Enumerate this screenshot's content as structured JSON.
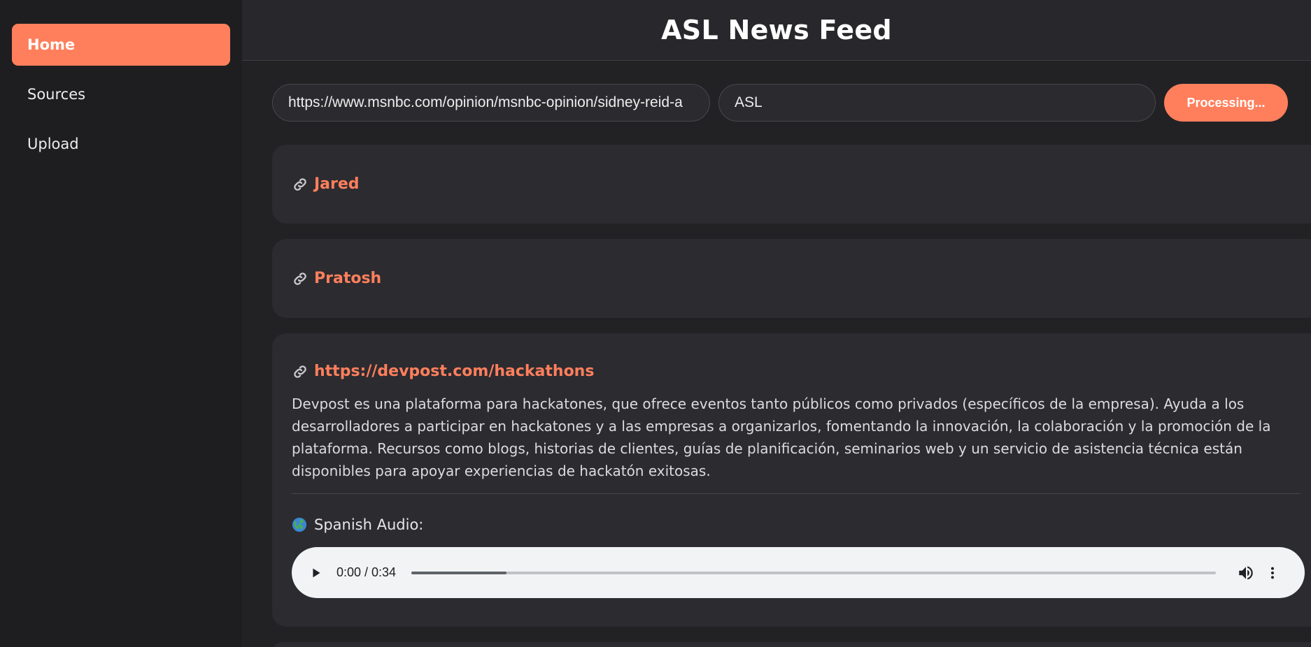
{
  "sidebar": {
    "items": [
      {
        "label": "Home",
        "active": true
      },
      {
        "label": "Sources",
        "active": false
      },
      {
        "label": "Upload",
        "active": false
      }
    ]
  },
  "header": {
    "title": "ASL News Feed"
  },
  "controls": {
    "url_value": "https://www.msnbc.com/opinion/msnbc-opinion/sidney-reid-a",
    "topic_value": "ASL",
    "process_label": "Processing..."
  },
  "feed": {
    "cards": [
      {
        "link_text": "Jared"
      },
      {
        "link_text": "Pratosh"
      },
      {
        "link_text": "https://devpost.com/hackathons",
        "summary": "Devpost es una plataforma para hackatones, que ofrece eventos tanto públicos como privados (específicos de la empresa). Ayuda a los desarrolladores a participar en hackatones y a las empresas a organizarlos, fomentando la innovación, la colaboración y la promoción de la plataforma. Recursos como blogs, historias de clientes, guías de planificación, seminarios web y un servicio de asistencia técnica están disponibles para apoyar experiencias de hackatón exitosas.",
        "audio_label": "Spanish Audio:",
        "audio_time": "0:00 / 0:34",
        "audio_progress": 0.118
      }
    ]
  },
  "colors": {
    "accent": "#ff7f5c",
    "background": "#222225",
    "card": "#2b2b30"
  },
  "icons": [
    "link-icon",
    "globe-icon",
    "play-icon",
    "volume-icon",
    "more-vertical-icon"
  ]
}
